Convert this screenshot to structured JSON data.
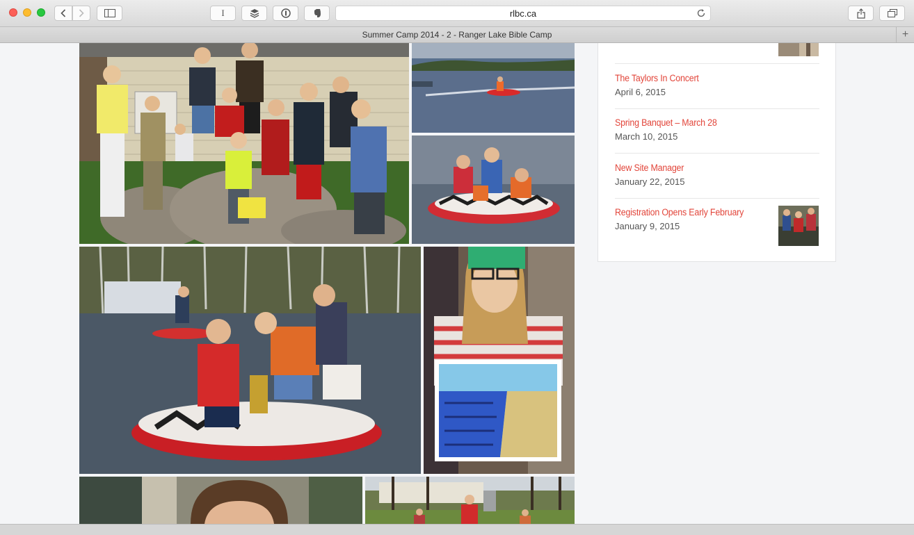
{
  "browser": {
    "url": "rlbc.ca",
    "tab_title": "Summer Camp 2014 - 2 - Ranger Lake Bible Camp",
    "new_tab_label": "+",
    "reader_label": "I"
  },
  "colors": {
    "accent": "#e2453a",
    "page_bg": "#f4f5f7"
  },
  "gallery": [
    {
      "name": "campers-group-photo",
      "alt": "campers group photo"
    },
    {
      "name": "lake-tubing-photo",
      "alt": "tube on lake"
    },
    {
      "name": "girls-tubing-photo",
      "alt": "girls on tube"
    },
    {
      "name": "boys-tube-photo",
      "alt": "boys on tube"
    },
    {
      "name": "girl-painting-photo",
      "alt": "girl with painting"
    },
    {
      "name": "girl-portrait-photo",
      "alt": "girl portrait"
    },
    {
      "name": "camp-grounds-photo",
      "alt": "camp grounds"
    }
  ],
  "sidebar": {
    "posts": [
      {
        "title": "The Taylors In Concert",
        "date": "April 6, 2015"
      },
      {
        "title": "Spring Banquet – March 28",
        "date": "March 10, 2015"
      },
      {
        "title": "New Site Manager",
        "date": "January 22, 2015"
      },
      {
        "title": "Registration Opens Early February",
        "date": "January 9, 2015"
      }
    ]
  }
}
